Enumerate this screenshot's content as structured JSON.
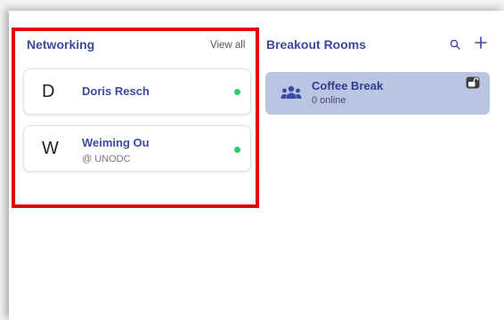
{
  "networking": {
    "title": "Networking",
    "view_all": "View all",
    "people": [
      {
        "initial": "D",
        "name": "Doris Resch",
        "org": "",
        "online": true
      },
      {
        "initial": "W",
        "name": "Weiming Ou",
        "org": "@ UNODC",
        "online": true
      }
    ]
  },
  "breakout": {
    "title": "Breakout Rooms",
    "rooms": [
      {
        "name": "Coffee Break",
        "count": "0 online"
      }
    ]
  },
  "colors": {
    "accent": "#3b4aa0",
    "room_bg": "#b9c5e2",
    "online": "#2ecc71",
    "highlight": "#e00000"
  }
}
